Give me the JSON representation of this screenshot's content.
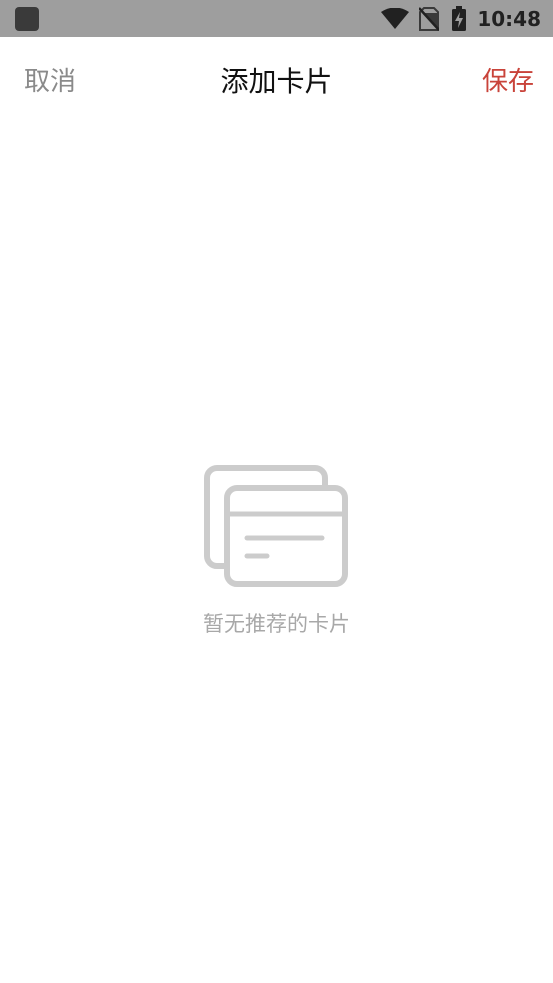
{
  "status_bar": {
    "time": "10:48",
    "icons": [
      "app-notification-icon",
      "wifi-icon",
      "no-sim-icon",
      "battery-charging-icon"
    ]
  },
  "nav": {
    "cancel_label": "取消",
    "title": "添加卡片",
    "save_label": "保存"
  },
  "empty_state": {
    "icon": "cards-icon",
    "message": "暂无推荐的卡片"
  },
  "colors": {
    "status_bar_bg": "#9e9e9e",
    "cancel": "#8a8a8a",
    "save_accent": "#c9433a",
    "empty_icon": "#cccccc",
    "empty_text": "#a8a8a8"
  }
}
